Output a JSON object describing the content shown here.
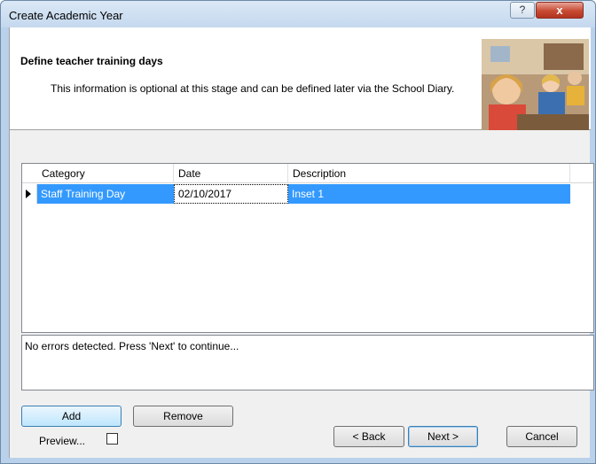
{
  "window": {
    "title": "Create Academic Year"
  },
  "title_buttons": {
    "help": "?",
    "close": "x"
  },
  "header": {
    "title": "Define teacher training days",
    "description": "This information is optional at this stage and can be defined later via the School Diary."
  },
  "grid": {
    "columns": [
      "Category",
      "Date",
      "Description"
    ],
    "rows": [
      {
        "category": "Staff Training Day",
        "date": "02/10/2017",
        "description": "Inset 1",
        "selected": true
      }
    ]
  },
  "messages": {
    "text": "No errors detected. Press 'Next' to continue..."
  },
  "buttons": {
    "add": "Add",
    "remove": "Remove",
    "back": "< Back",
    "next": "Next >",
    "cancel": "Cancel"
  },
  "preview": {
    "label": "Preview...",
    "checked": false
  },
  "colors": {
    "selection": "#3399ff",
    "window_frame": "#b9d1ea",
    "dialog_bg": "#f0f0f0"
  }
}
